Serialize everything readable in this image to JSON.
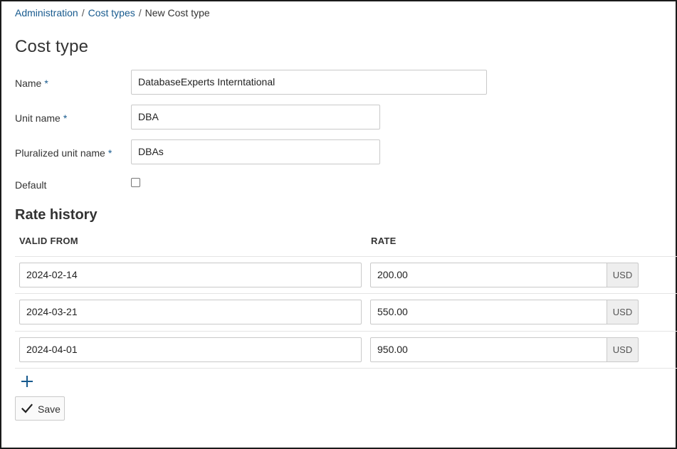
{
  "breadcrumb": {
    "items": [
      "Administration",
      "Cost types"
    ],
    "separator": "/",
    "current": "New Cost type"
  },
  "page_title": "Cost type",
  "form": {
    "name": {
      "label": "Name",
      "required_mark": "*",
      "value": "DatabaseExperts Interntational"
    },
    "unit_name": {
      "label": "Unit name",
      "required_mark": "*",
      "value": "DBA"
    },
    "pluralized_unit_name": {
      "label": "Pluralized unit name",
      "required_mark": "*",
      "value": "DBAs"
    },
    "default": {
      "label": "Default",
      "checked": false
    }
  },
  "rate_history": {
    "title": "Rate history",
    "columns": [
      "VALID FROM",
      "RATE"
    ],
    "currency": "USD",
    "rows": [
      {
        "valid_from": "2024-02-14",
        "rate": "200.00"
      },
      {
        "valid_from": "2024-03-21",
        "rate": "550.00"
      },
      {
        "valid_from": "2024-04-01",
        "rate": "950.00"
      }
    ]
  },
  "actions": {
    "add_icon": "plus-icon",
    "save_icon": "checkmark-icon",
    "save_label": "Save"
  },
  "colors": {
    "link": "#175a8e",
    "text": "#333333",
    "border": "#c9c9c9",
    "addon_bg": "#eeeeee"
  }
}
